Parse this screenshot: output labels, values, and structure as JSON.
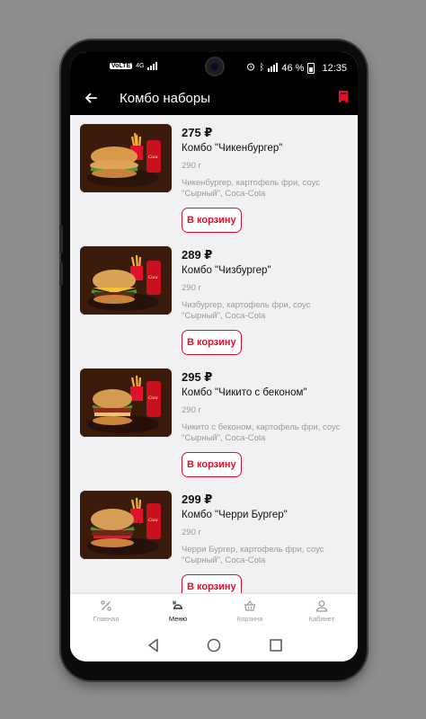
{
  "status_bar": {
    "carrier_badge": "VoLTE",
    "network": "4G",
    "battery_percent": "46 %",
    "time": "12:35"
  },
  "header": {
    "title": "Комбо наборы",
    "back_icon": "arrow-left-icon",
    "bookmark_icon": "bookmark-icon"
  },
  "colors": {
    "accent": "#e0112b",
    "header_bg": "#000000",
    "list_bg": "#f1f1f3"
  },
  "products": [
    {
      "price": "275 ₽",
      "name": "Комбо \"Чикенбургер\"",
      "weight": "290 г",
      "description": "Чикенбургер, картофель фри, соус \"Сырный\", Coca-Cola",
      "button": "В корзину"
    },
    {
      "price": "289 ₽",
      "name": "Комбо \"Чизбургер\"",
      "weight": "290 г",
      "description": "Чизбургер, картофель фри, соус \"Сырный\", Coca-Cola",
      "button": "В корзину"
    },
    {
      "price": "295 ₽",
      "name": "Комбо \"Чикито с беконом\"",
      "weight": "290 г",
      "description": "Чикито с беконом, картофель фри, соус \"Сырный\", Coca-Cola",
      "button": "В корзину"
    },
    {
      "price": "299 ₽",
      "name": "Комбо \"Черри Бургер\"",
      "weight": "290 г",
      "description": "Черри Бургер, картофель фри, соус \"Сырный\", Coca-Cola",
      "button": "В корзину"
    }
  ],
  "bottom_nav": [
    {
      "label": "Главная",
      "icon": "percent-icon",
      "active": false
    },
    {
      "label": "Меню",
      "icon": "menu-dish-icon",
      "active": true
    },
    {
      "label": "Корзина",
      "icon": "basket-icon",
      "active": false
    },
    {
      "label": "Кабинет",
      "icon": "user-icon",
      "active": false
    }
  ],
  "system_nav": [
    "back-triangle-icon",
    "home-circle-icon",
    "recents-square-icon"
  ]
}
